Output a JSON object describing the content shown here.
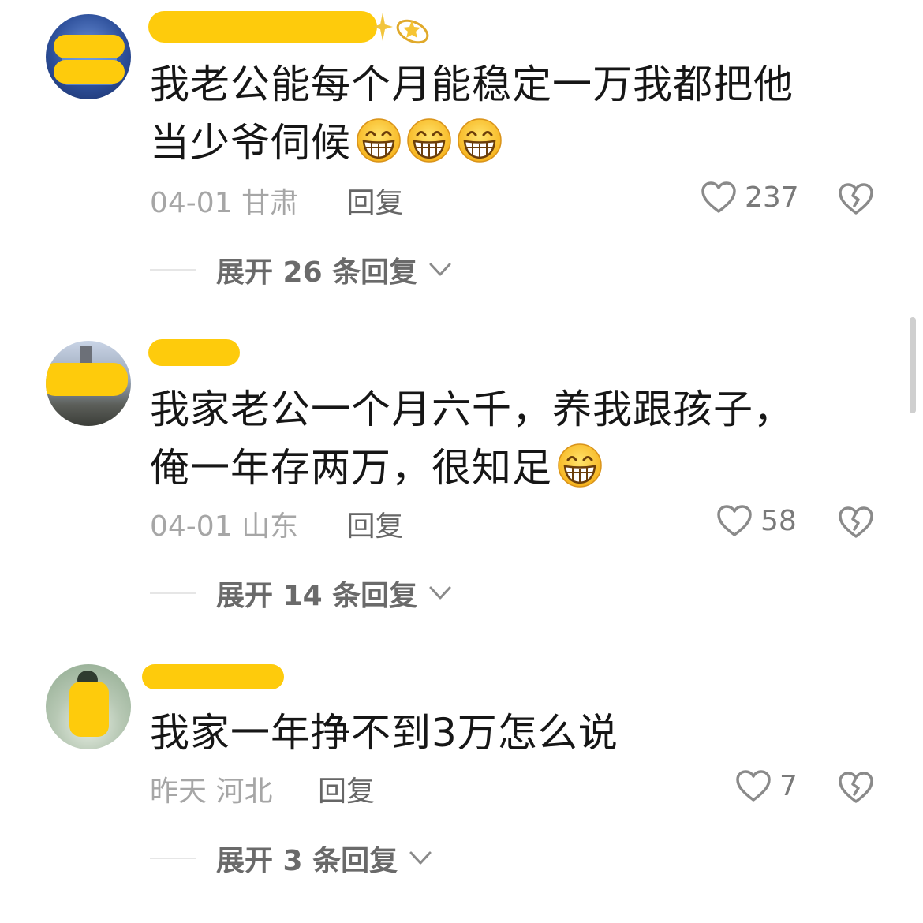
{
  "comments": [
    {
      "text_line1": "我老公能每个月能稳定一万我都把他",
      "text_line2": "当少爷伺候",
      "date": "04-01",
      "location": "甘肃",
      "reply_label": "回复",
      "likes": "237",
      "expand_label": "展开 26 条回复"
    },
    {
      "text_line1": "我家老公一个月六千，养我跟孩子，",
      "text_line2": "俺一年存两万，很知足",
      "date": "04-01",
      "location": "山东",
      "reply_label": "回复",
      "likes": "58",
      "expand_label": "展开 14 条回复"
    },
    {
      "text_line1": "我家一年挣不到3万怎么说",
      "date": "昨天",
      "location": "河北",
      "reply_label": "回复",
      "likes": "7",
      "expand_label": "展开 3 条回复"
    }
  ],
  "icons": {
    "like": "heart-outline-icon",
    "dislike": "broken-heart-icon",
    "expand": "chevron-down-icon",
    "emoji": "grinning-face-emoji"
  },
  "colors": {
    "redaction": "#fecb0c",
    "meta_gray": "#a6a6a6"
  }
}
